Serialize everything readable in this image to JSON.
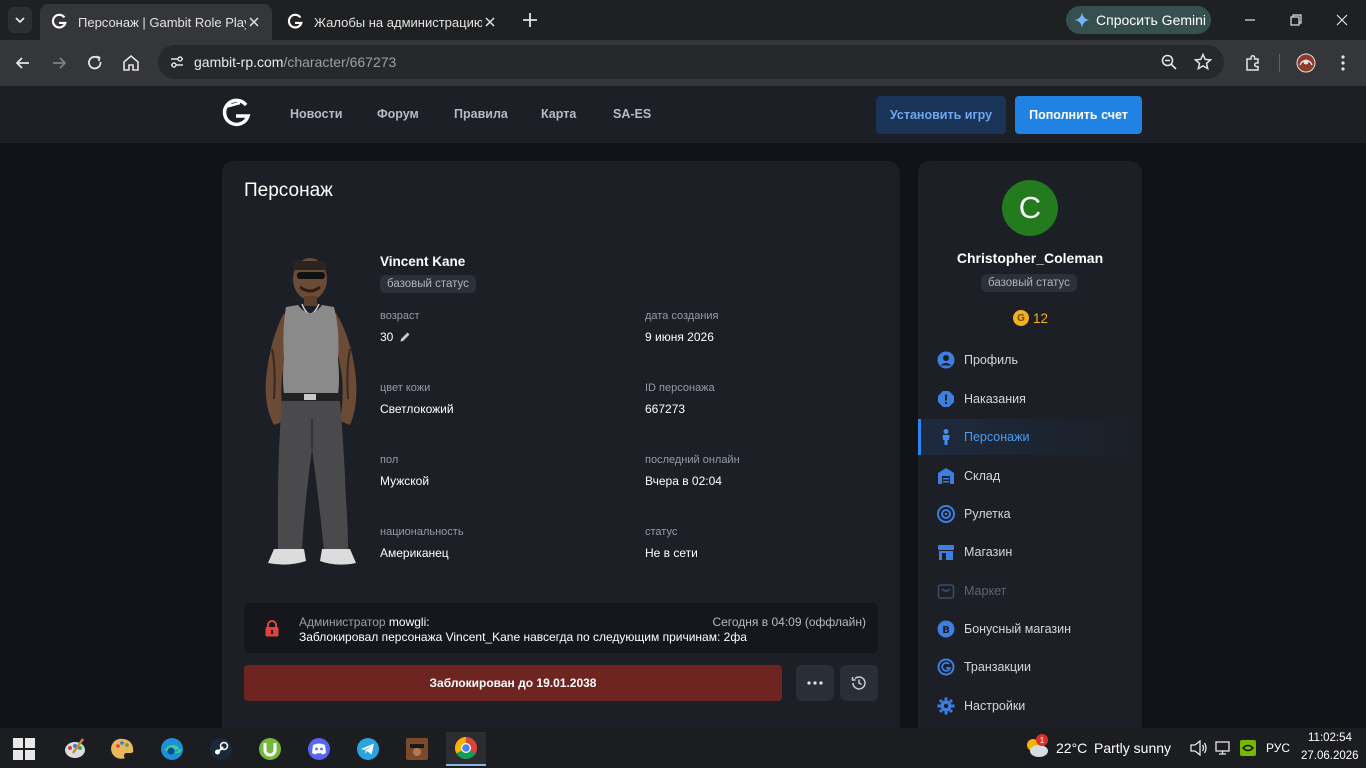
{
  "browser": {
    "tabs": [
      {
        "title": "Персонаж | Gambit Role Play"
      },
      {
        "title": "Жалобы на администрацию | G"
      }
    ],
    "gemini_label": "Спросить Gemini",
    "url_host": "gambit-rp.com",
    "url_path": "/character/667273"
  },
  "header": {
    "nav": [
      "Новости",
      "Форум",
      "Правила",
      "Карта",
      "SA-ES"
    ],
    "install_label": "Установить игру",
    "topup_label": "Пополнить счет"
  },
  "character": {
    "page_title": "Персонаж",
    "name": "Vincent Kane",
    "status_badge": "базовый статус",
    "fields": [
      {
        "label": "возраст",
        "value": "30"
      },
      {
        "label": "дата создания",
        "value": "9 июня 2026"
      },
      {
        "label": "цвет кожи",
        "value": "Светлокожий"
      },
      {
        "label": "ID персонажа",
        "value": "667273"
      },
      {
        "label": "пол",
        "value": "Мужской"
      },
      {
        "label": "последний онлайн",
        "value": "Вчера в 02:04"
      },
      {
        "label": "национальность",
        "value": "Американец"
      },
      {
        "label": "статус",
        "value": "Не в сети"
      }
    ]
  },
  "ban_notice": {
    "prefix": "Администратор",
    "admin": "mowgli:",
    "time": "Сегодня в 04:09 (оффлайн)",
    "message": "Заблокировал персонажа Vincent_Kane навсегда по следующим причинам: 2фа",
    "ban_button": "Заблокирован до 19.01.2038"
  },
  "user": {
    "initial": "C",
    "name": "Christopher_Coleman",
    "status_badge": "базовый статус",
    "coin_symbol": "G",
    "coins": "12"
  },
  "menu": [
    {
      "label": "Профиль",
      "icon": "user-icon"
    },
    {
      "label": "Наказания",
      "icon": "warning-icon"
    },
    {
      "label": "Персонажи",
      "icon": "person-icon",
      "active": true
    },
    {
      "label": "Склад",
      "icon": "warehouse-icon"
    },
    {
      "label": "Рулетка",
      "icon": "roulette-icon"
    },
    {
      "label": "Магазин",
      "icon": "shop-icon"
    },
    {
      "label": "Маркет",
      "icon": "market-icon",
      "disabled": true
    },
    {
      "label": "Бонусный магазин",
      "icon": "bonus-shop-icon"
    },
    {
      "label": "Транзакции",
      "icon": "transactions-icon"
    },
    {
      "label": "Настройки",
      "icon": "settings-icon"
    }
  ],
  "taskbar": {
    "temperature": "22°C",
    "weather": "Partly sunny",
    "weather_badge": "1",
    "language": "РУС",
    "time": "11:02:54",
    "date": "27.06.2026"
  },
  "colors": {
    "accent": "#2082e3",
    "ban_red": "#6e2420",
    "avatar_green": "#237a1f",
    "coin_gold": "#f2b01e"
  }
}
